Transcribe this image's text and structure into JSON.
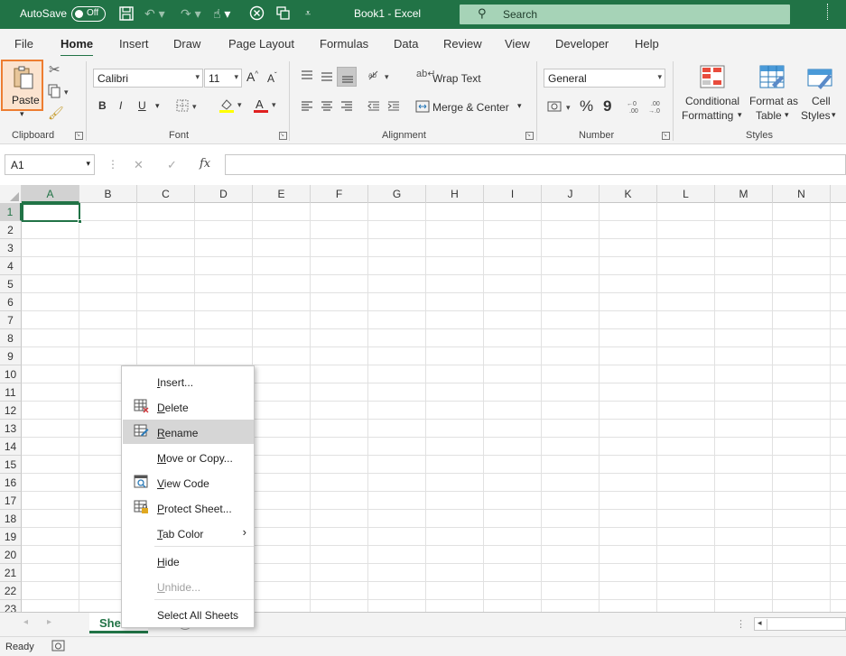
{
  "titlebar": {
    "autosave_label": "AutoSave",
    "autosave_state": "Off",
    "title": "Book1  -  Excel",
    "search_placeholder": "Search"
  },
  "tabs": [
    "File",
    "Home",
    "Insert",
    "Draw",
    "Page Layout",
    "Formulas",
    "Data",
    "Review",
    "View",
    "Developer",
    "Help"
  ],
  "ribbon": {
    "clipboard": {
      "label": "Clipboard",
      "paste": "Paste"
    },
    "font": {
      "label": "Font",
      "name": "Calibri",
      "size": "11",
      "bold": "B",
      "italic": "I",
      "underline": "U"
    },
    "alignment": {
      "label": "Alignment",
      "wrap": "Wrap Text",
      "merge": "Merge & Center"
    },
    "number": {
      "label": "Number",
      "format": "General",
      "percent": "%",
      "comma": "9"
    },
    "styles": {
      "label": "Styles",
      "conditional_1": "Conditional",
      "conditional_2": "Formatting",
      "format_table_1": "Format as",
      "format_table_2": "Table",
      "cell_styles_1": "Cell",
      "cell_styles_2": "Styles"
    }
  },
  "formula_bar": {
    "name_box": "A1",
    "fx": "fx",
    "cancel": "✕",
    "enter": "✓"
  },
  "grid": {
    "columns": [
      "A",
      "B",
      "C",
      "D",
      "E",
      "F",
      "G",
      "H",
      "I",
      "J",
      "K",
      "L",
      "M",
      "N"
    ],
    "rows": [
      "1",
      "2",
      "3",
      "4",
      "5",
      "6",
      "7",
      "8",
      "9",
      "10",
      "11",
      "12",
      "13",
      "14",
      "15",
      "16",
      "17",
      "18",
      "19",
      "20",
      "21",
      "22",
      "23"
    ],
    "selected_col": "A",
    "selected_row": "1"
  },
  "sheet_tab": "She",
  "status": {
    "ready": "Ready"
  },
  "context_menu": [
    {
      "pre": "",
      "u": "I",
      "post": "nsert...",
      "icon": "",
      "state": "normal"
    },
    {
      "pre": "",
      "u": "D",
      "post": "elete",
      "icon": "delete-sheet-icon",
      "state": "normal"
    },
    {
      "pre": "",
      "u": "R",
      "post": "ename",
      "icon": "rename-sheet-icon",
      "state": "highlight"
    },
    {
      "pre": "",
      "u": "M",
      "post": "ove or Copy...",
      "icon": "",
      "state": "normal"
    },
    {
      "pre": "",
      "u": "V",
      "post": "iew Code",
      "icon": "view-code-icon",
      "state": "normal"
    },
    {
      "pre": "",
      "u": "P",
      "post": "rotect Sheet...",
      "icon": "protect-sheet-icon",
      "state": "normal"
    },
    {
      "pre": "",
      "u": "T",
      "post": "ab Color",
      "icon": "",
      "state": "normal",
      "submenu": true
    },
    {
      "pre": "",
      "u": "H",
      "post": "ide",
      "icon": "",
      "state": "normal"
    },
    {
      "pre": "",
      "u": "U",
      "post": "nhide...",
      "icon": "",
      "state": "disabled"
    },
    {
      "pre": "Select All Sheets",
      "u": "",
      "post": "",
      "icon": "",
      "state": "normal"
    }
  ]
}
